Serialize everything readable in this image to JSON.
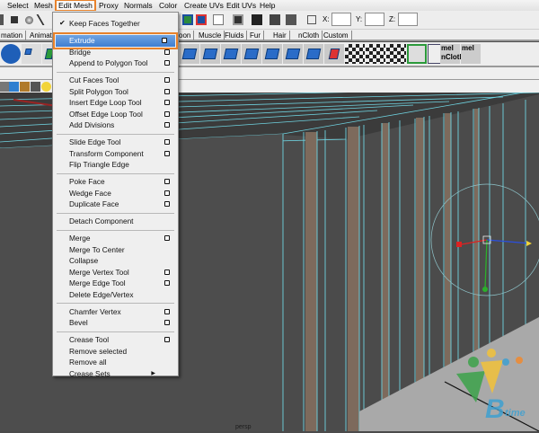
{
  "menubar": {
    "items": [
      "Select",
      "Mesh",
      "Edit Mesh",
      "Proxy",
      "Normals",
      "Color",
      "Create UVs",
      "Edit UVs",
      "Help"
    ],
    "active": "Edit Mesh"
  },
  "toolbar": {
    "x_label": "X:",
    "y_label": "Y:",
    "z_label": "Z:",
    "x_value": "",
    "y_value": "",
    "z_value": ""
  },
  "shelf_tabs": [
    "mation",
    "Animation",
    "oon",
    "Muscle",
    "Fluids",
    "Fur",
    "Hair",
    "nCloth",
    "Custom"
  ],
  "shelf_labels": {
    "mel1": "mel",
    "ncloth": "nCloth",
    "mel2": "mel"
  },
  "menu": {
    "title": "Edit Mesh",
    "items": [
      {
        "label": "Keep Faces Together",
        "checked": true
      },
      {
        "sep": true
      },
      {
        "label": "Extrude",
        "option": true,
        "highlighted": true
      },
      {
        "label": "Bridge",
        "option": true
      },
      {
        "label": "Append to Polygon Tool",
        "option": true
      },
      {
        "sep": true
      },
      {
        "label": "Cut Faces Tool",
        "option": true
      },
      {
        "label": "Split Polygon Tool",
        "option": true
      },
      {
        "label": "Insert Edge Loop Tool",
        "option": true
      },
      {
        "label": "Offset Edge Loop Tool",
        "option": true
      },
      {
        "label": "Add Divisions",
        "option": true
      },
      {
        "sep": true
      },
      {
        "label": "Slide Edge Tool",
        "option": true
      },
      {
        "label": "Transform Component",
        "option": true
      },
      {
        "label": "Flip Triangle Edge"
      },
      {
        "sep": true
      },
      {
        "label": "Poke Face",
        "option": true
      },
      {
        "label": "Wedge Face",
        "option": true
      },
      {
        "label": "Duplicate Face",
        "option": true
      },
      {
        "sep": true
      },
      {
        "label": "Detach Component"
      },
      {
        "sep": true
      },
      {
        "label": "Merge",
        "option": true
      },
      {
        "label": "Merge To Center"
      },
      {
        "label": "Collapse"
      },
      {
        "label": "Merge Vertex Tool",
        "option": true
      },
      {
        "label": "Merge Edge Tool",
        "option": true
      },
      {
        "label": "Delete Edge/Vertex"
      },
      {
        "sep": true
      },
      {
        "label": "Chamfer Vertex",
        "option": true
      },
      {
        "label": "Bevel",
        "option": true
      },
      {
        "sep": true
      },
      {
        "label": "Crease Tool",
        "option": true
      },
      {
        "label": "Remove selected"
      },
      {
        "label": "Remove all"
      },
      {
        "label": "Crease Sets",
        "submenu": true
      }
    ]
  },
  "viewport": {
    "camera": "persp"
  },
  "watermark": {
    "text": "7Btime"
  },
  "colors": {
    "accent": "#e8822b",
    "highlight": "#3f7dd0",
    "wire": "#6fd3e0",
    "stripe": "#7d6a5c",
    "floor": "#a9a9a9"
  }
}
